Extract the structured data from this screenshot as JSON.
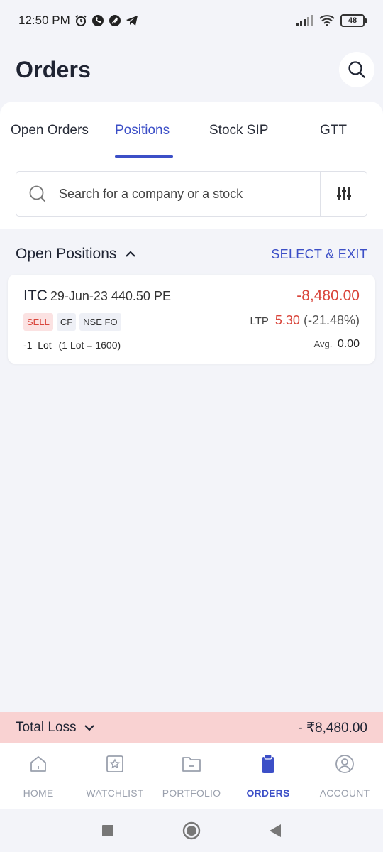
{
  "status_bar": {
    "time": "12:50 PM",
    "battery": "48"
  },
  "header": {
    "title": "Orders"
  },
  "tabs": [
    {
      "label": "Open Orders"
    },
    {
      "label": "Positions"
    },
    {
      "label": "Stock SIP"
    },
    {
      "label": "GTT"
    }
  ],
  "active_tab": "Positions",
  "search": {
    "placeholder": "Search for a company or a stock"
  },
  "section": {
    "title": "Open Positions",
    "action": "SELECT & EXIT"
  },
  "position": {
    "symbol": "ITC",
    "contract": "29-Jun-23 440.50 PE",
    "pnl": "-8,480.00",
    "tags": [
      "SELL",
      "CF",
      "NSE FO"
    ],
    "ltp_label": "LTP",
    "ltp_price": "5.30",
    "ltp_change": "(-21.48%)",
    "qty": "-1",
    "qty_unit": "Lot",
    "lot_note": "(1 Lot = 1600)",
    "avg_label": "Avg.",
    "avg_value": "0.00"
  },
  "total": {
    "label": "Total Loss",
    "value": "- ₹8,480.00"
  },
  "bottom_nav": [
    {
      "label": "HOME",
      "icon": "home-icon"
    },
    {
      "label": "WATCHLIST",
      "icon": "watchlist-icon"
    },
    {
      "label": "PORTFOLIO",
      "icon": "portfolio-icon"
    },
    {
      "label": "ORDERS",
      "icon": "orders-icon"
    },
    {
      "label": "ACCOUNT",
      "icon": "account-icon"
    }
  ],
  "colors": {
    "accent": "#3c4fc7",
    "loss": "#d9453b",
    "loss_bg": "#f9d2d2",
    "background": "#f3f4f9"
  }
}
